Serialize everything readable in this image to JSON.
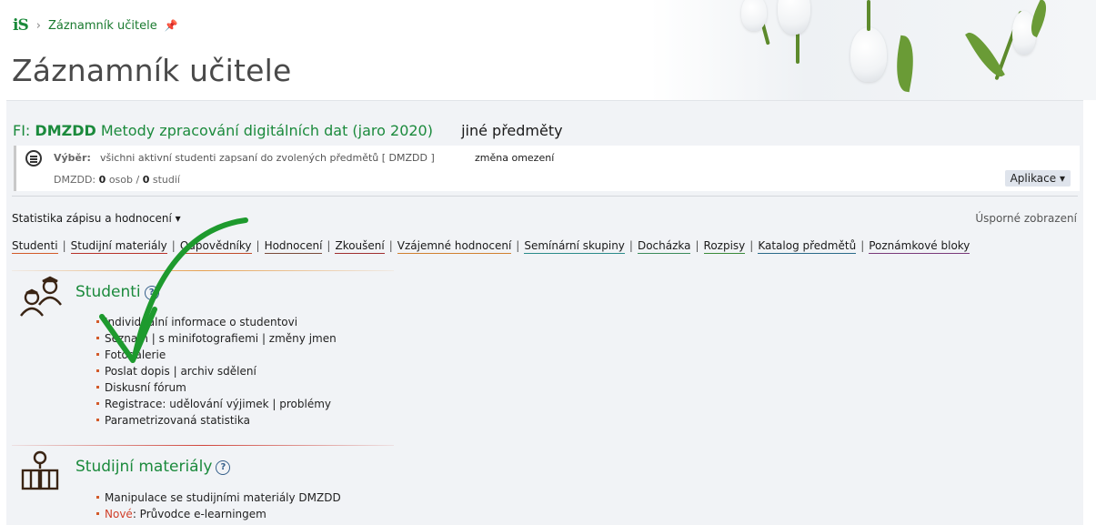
{
  "header": {
    "logo_text": "iS",
    "breadcrumb_label": "Záznamník učitele",
    "page_title": "Záznamník učitele"
  },
  "course": {
    "prefix": "FI:",
    "code": "DMZDD",
    "name": "Metody zpracování digitálních dat (jaro 2020)",
    "other_subjects": "jiné předměty"
  },
  "filter": {
    "label": "Výběr:",
    "text": "všichni aktivní studenti zapsaní do zvolených předmětů [ DMZDD ]",
    "change_link": "změna omezení",
    "counts_prefix": "DMZDD:",
    "persons": "0",
    "persons_label": "osob /",
    "studies": "0",
    "studies_label": "studií",
    "apps_button": "Aplikace"
  },
  "stats_menu": "Statistika zápisu a hodnocení",
  "compact_view": "Úsporné zobrazení",
  "tabs": [
    {
      "label": "Studenti",
      "color": "#d35a2a"
    },
    {
      "label": "Studijní materiály",
      "color": "#b8322a"
    },
    {
      "label": "Odpovědníky",
      "color": "#c04a2a"
    },
    {
      "label": "Hodnocení",
      "color": "#7a4a3a"
    },
    {
      "label": "Zkoušení",
      "color": "#a03030"
    },
    {
      "label": "Vzájemné hodnocení",
      "color": "#d08030"
    },
    {
      "label": "Semínární skupiny",
      "color": "#2a8a8a"
    },
    {
      "label": "Docházka",
      "color": "#3a8a5a"
    },
    {
      "label": "Rozpisy",
      "color": "#3a8a3a"
    },
    {
      "label": "Katalog předmětů",
      "color": "#2a6a8a"
    },
    {
      "label": "Poznámkové bloky",
      "color": "#7a3a7a"
    }
  ],
  "sections": [
    {
      "title": "Studenti",
      "items": [
        "Individuální informace o studentovi",
        "Seznam | s minifotografiemi | změny jmen",
        "Fotogalerie",
        "Poslat dopis | archiv sdělení",
        "Diskusní fórum",
        "Registrace: udělování výjimek | problémy",
        "Parametrizovaná statistika"
      ]
    },
    {
      "title": "Studijní materiály",
      "items": [
        "Manipulace se studijními materiály DMZDD"
      ],
      "new_label": "Nové",
      "new_item": ": Průvodce e-learningem"
    }
  ],
  "colors": {
    "accent_green": "#1b8a3c",
    "annotation_arrow": "#1e9a2e",
    "bullet": "#d35a2a"
  }
}
